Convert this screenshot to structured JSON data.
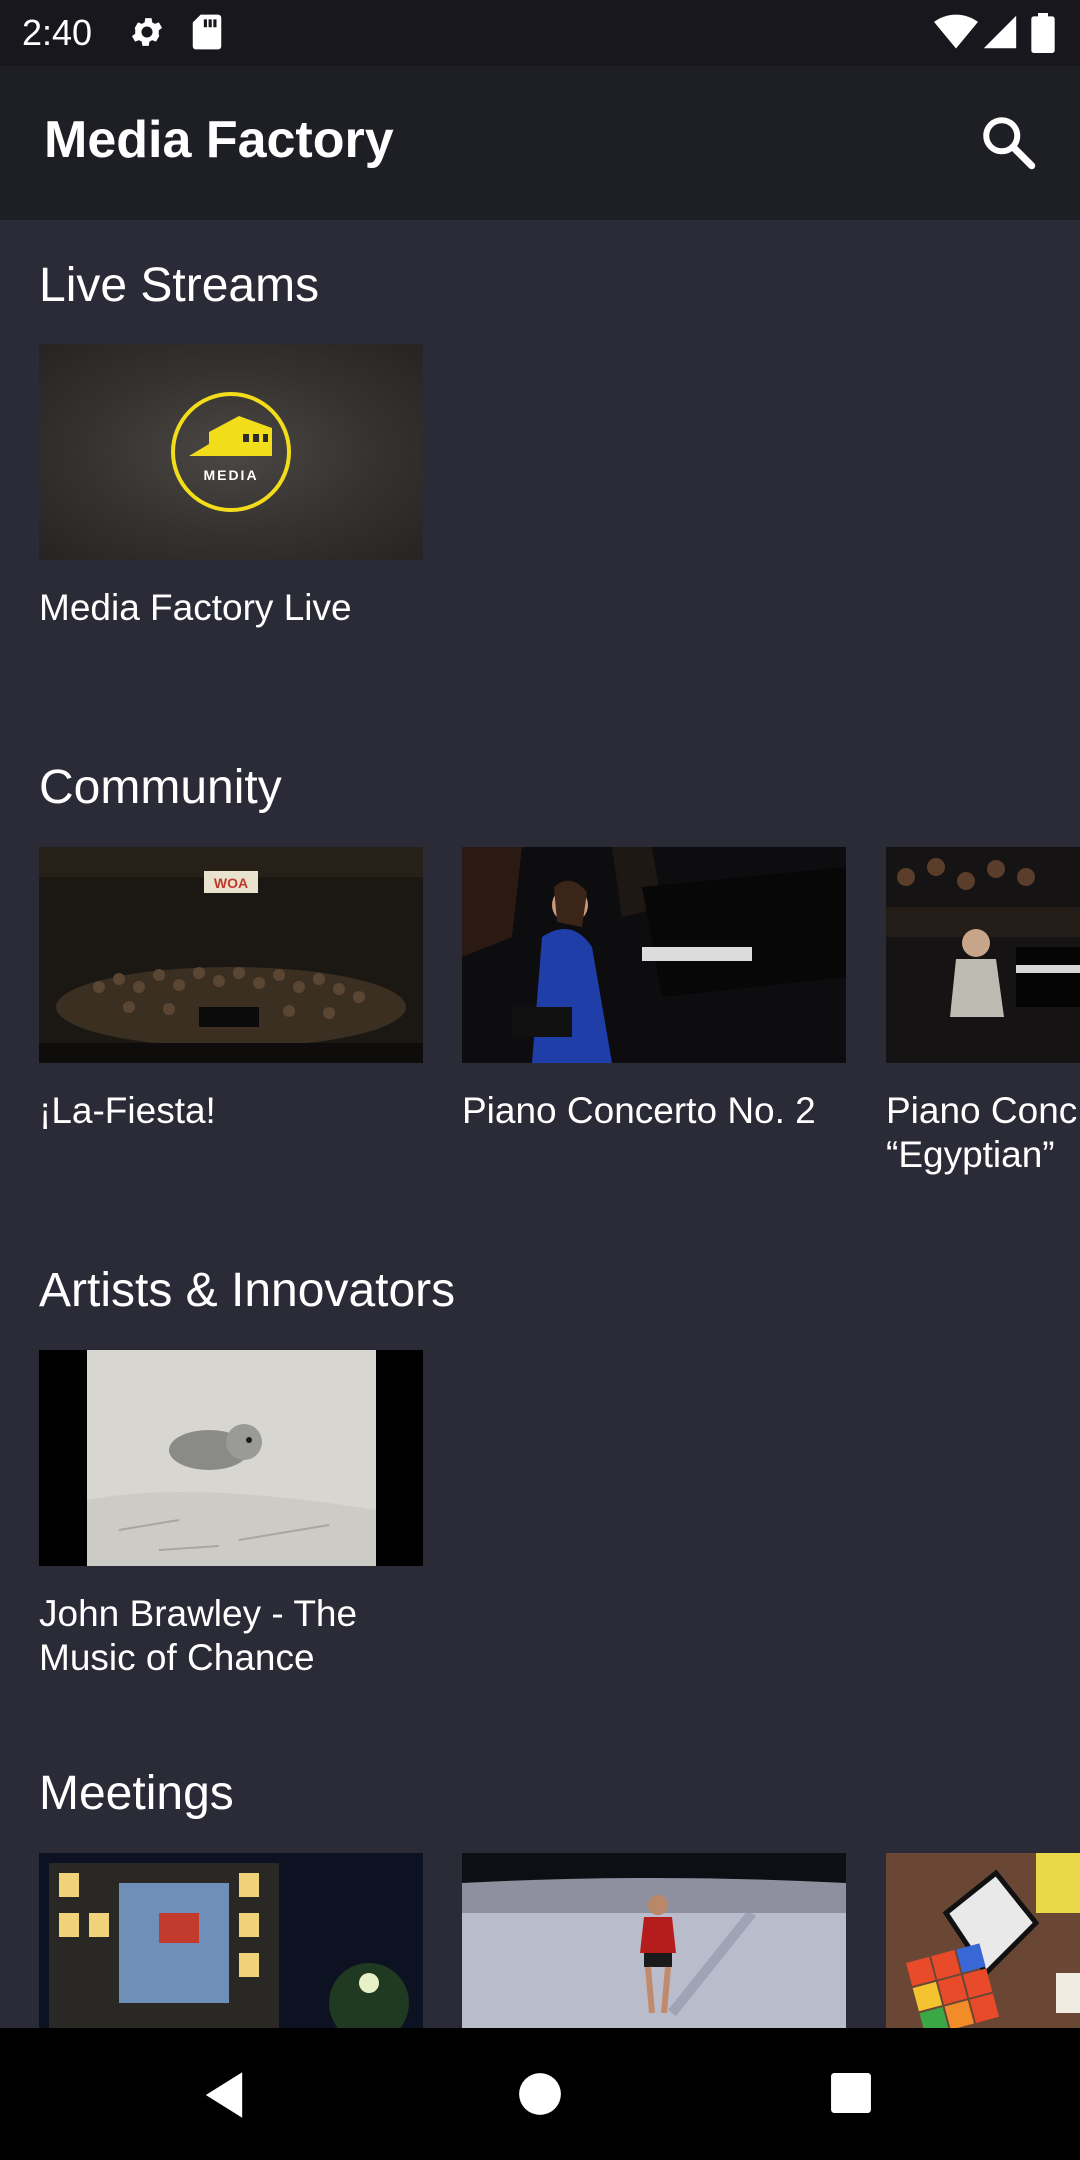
{
  "status_bar": {
    "time": "2:40",
    "left_icons": [
      "settings-icon",
      "sd-card-icon"
    ],
    "right_icons": [
      "wifi-icon",
      "cell-signal-icon",
      "battery-icon"
    ]
  },
  "app_bar": {
    "title": "Media Factory",
    "search_icon": "search-icon"
  },
  "sections": [
    {
      "title": "Live Streams",
      "items": [
        {
          "title": "Media Factory Live",
          "logo_text": "MEDIA"
        }
      ]
    },
    {
      "title": "Community",
      "items": [
        {
          "title": "¡La-Fiesta!",
          "banner_text": "WOA"
        },
        {
          "title": "Piano Concerto No. 2"
        },
        {
          "title_line1": "Piano Conc",
          "title_line2": "“Egyptian”"
        }
      ]
    },
    {
      "title": "Artists & Innovators",
      "items": [
        {
          "title_line1": "John Brawley - The",
          "title_line2": "Music of Chance"
        }
      ]
    },
    {
      "title": "Meetings",
      "items": [
        {
          "thumb": "building-night"
        },
        {
          "thumb": "person-snow"
        },
        {
          "thumb": "rubiks-cubes"
        }
      ]
    }
  ],
  "nav_bar": {
    "icons": [
      "back-icon",
      "home-icon",
      "recents-icon"
    ]
  },
  "colors": {
    "background": "#2b2a37",
    "app_bar": "#1e1e25",
    "status_bar": "#17171d",
    "logo_yellow": "#f2dd1b"
  }
}
